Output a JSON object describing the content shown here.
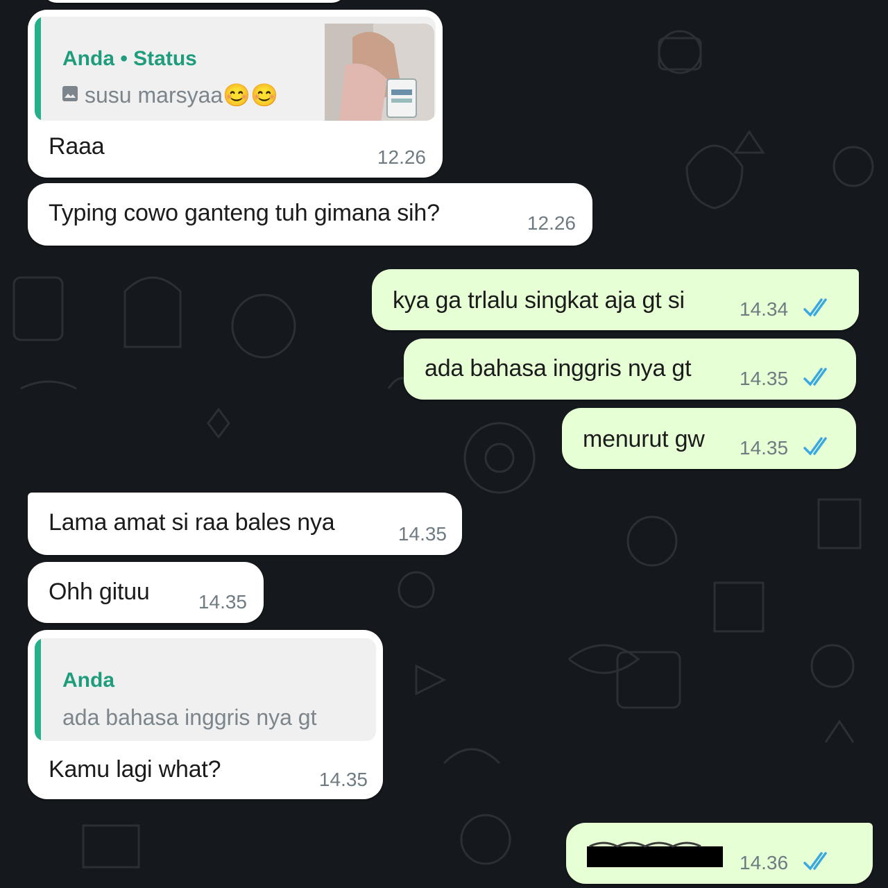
{
  "colors": {
    "background": "#15191d",
    "incoming_bubble": "#ffffff",
    "outgoing_bubble": "#e6ffd4",
    "quote_accent": "#25b08a",
    "read_ticks": "#3aa7e0"
  },
  "messages": [
    {
      "direction": "incoming",
      "quote": {
        "name": "Anda • Status",
        "text": "susu marsyaa😊😊",
        "icon": "image-icon"
      },
      "text": "Raaa",
      "time": "12.26"
    },
    {
      "direction": "incoming",
      "text": "Typing cowo ganteng tuh gimana sih?",
      "time": "12.26"
    },
    {
      "direction": "outgoing",
      "text": "kya ga trlalu singkat aja gt si",
      "time": "14.34",
      "status": "read"
    },
    {
      "direction": "outgoing",
      "text": "ada bahasa inggris nya gt",
      "time": "14.35",
      "status": "read"
    },
    {
      "direction": "outgoing",
      "text": "menurut gw",
      "time": "14.35",
      "status": "read"
    },
    {
      "direction": "incoming",
      "text": "Lama amat si raa bales nya",
      "time": "14.35"
    },
    {
      "direction": "incoming",
      "text": "Ohh gituu",
      "time": "14.35"
    },
    {
      "direction": "incoming",
      "quote": {
        "name": "Anda",
        "text": "ada bahasa inggris nya gt"
      },
      "text": "Kamu lagi what?",
      "time": "14.35"
    },
    {
      "direction": "outgoing",
      "text": "",
      "time": "14.36",
      "status": "read",
      "redacted": true
    }
  ]
}
